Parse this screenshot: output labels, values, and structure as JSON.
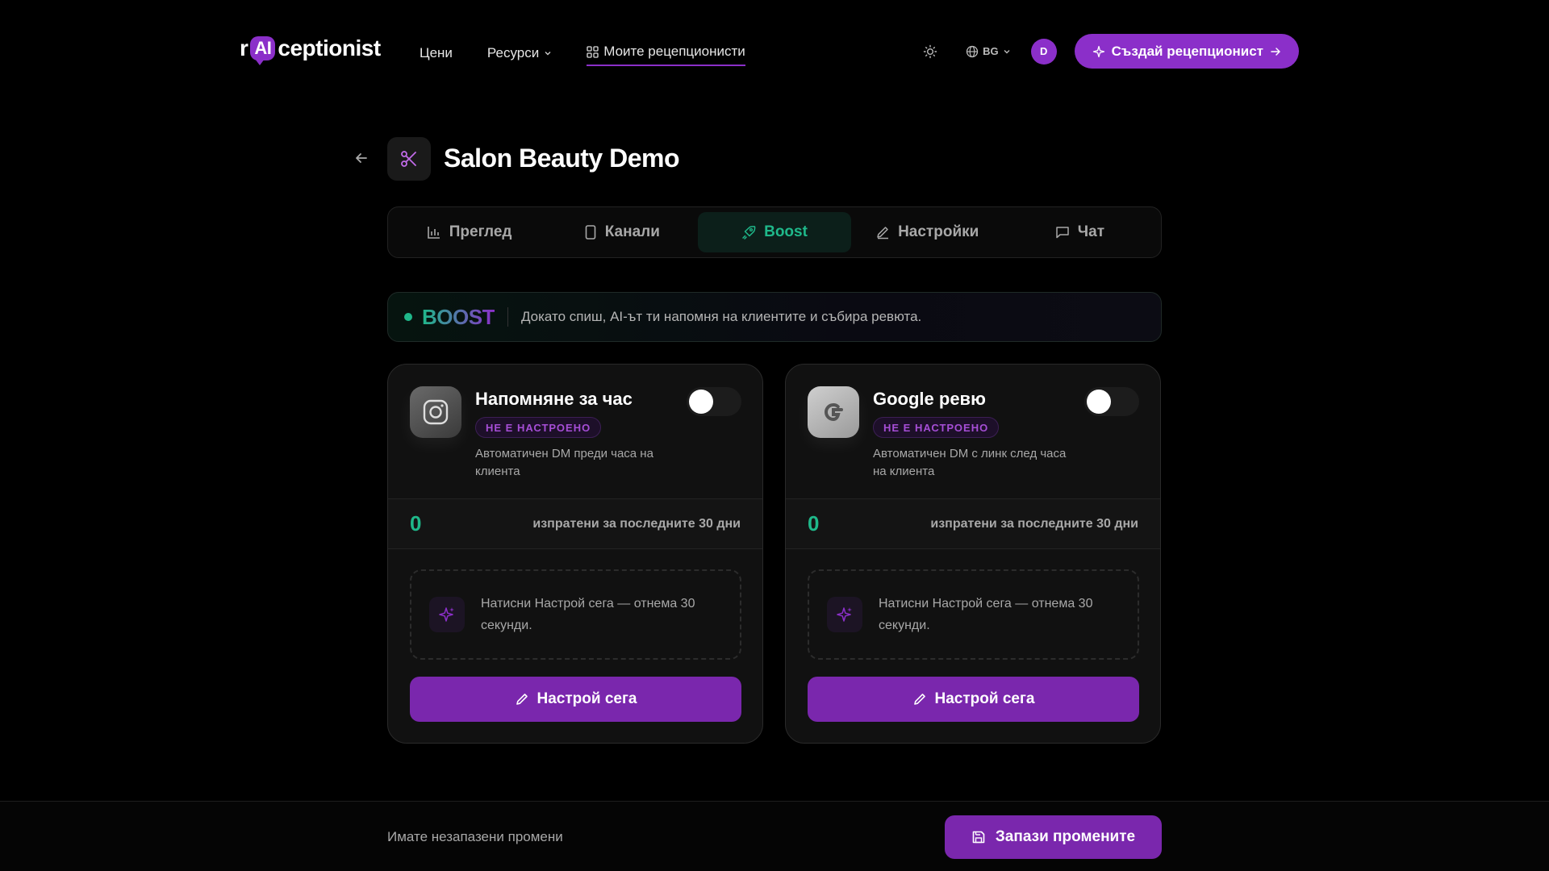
{
  "nav": {
    "logo_left": "r",
    "logo_ai": "AI",
    "logo_right": "ceptionist",
    "links": [
      {
        "label": "Цени"
      },
      {
        "label": "Ресурси"
      },
      {
        "label": "Моите рецепционисти"
      }
    ],
    "lang": "BG",
    "avatar_initial": "D",
    "cta_label": "Създай рецепционист"
  },
  "header": {
    "title": "Salon Beauty Demo"
  },
  "tabs": [
    {
      "label": "Преглед",
      "icon": "bar-chart-icon"
    },
    {
      "label": "Канали",
      "icon": "phone-icon"
    },
    {
      "label": "Boost",
      "icon": "rocket-icon",
      "active": true
    },
    {
      "label": "Настройки",
      "icon": "pencil-icon"
    },
    {
      "label": "Чат",
      "icon": "chat-icon"
    }
  ],
  "banner": {
    "title": "BOOST",
    "text": "Докато спиш, AI-ът ти напомня на клиентите и събира ревюта."
  },
  "cards": [
    {
      "icon": "instagram-icon",
      "title": "Напомняне за час",
      "badge": "НЕ Е НАСТРОЕНО",
      "description": "Автоматичен DM преди часа на клиента",
      "enabled": false,
      "count": "0",
      "count_label": "изпратени за последните 30 дни",
      "hint": "Натисни Настрой сега — отнема 30 секунди.",
      "button": "Настрой сега"
    },
    {
      "icon": "google-icon",
      "title": "Google ревю",
      "badge": "НЕ Е НАСТРОЕНО",
      "description": "Автоматичен DM с линк след часа на клиента",
      "enabled": false,
      "count": "0",
      "count_label": "изпратени за последните 30 дни",
      "hint": "Натисни Настрой сега — отнема 30 секунди.",
      "button": "Настрой сега"
    }
  ],
  "footer": {
    "message": "Имате незапазени промени",
    "save_label": "Запази промените"
  },
  "colors": {
    "accent": "#8b2fc9",
    "success": "#1fb88a",
    "background": "#000000"
  }
}
